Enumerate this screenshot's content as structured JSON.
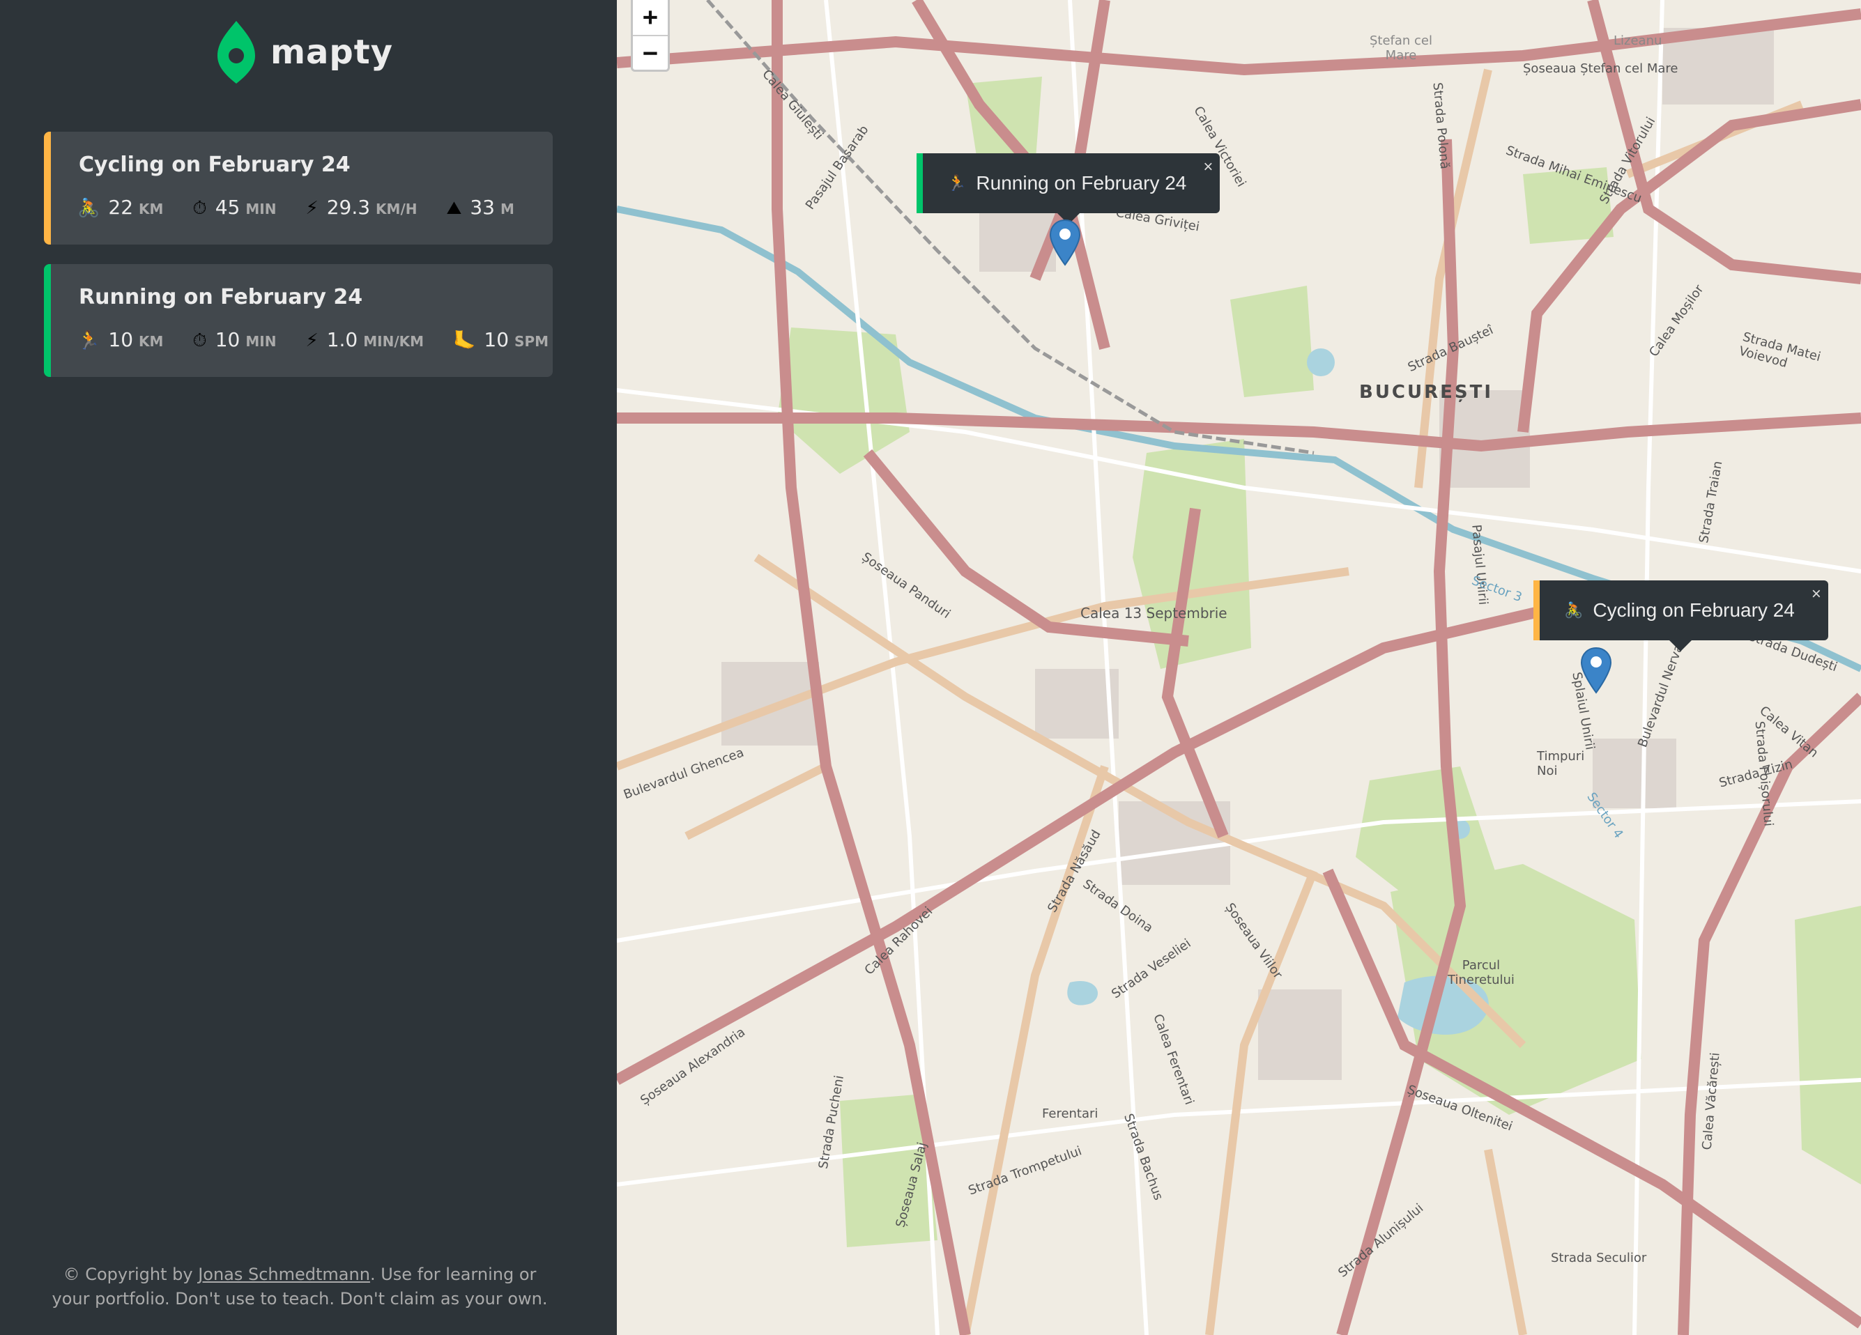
{
  "app": {
    "name": "mapty"
  },
  "workouts": [
    {
      "type": "cycling",
      "title": "Cycling on February 24",
      "details": [
        {
          "icon": "🚴",
          "value": "22",
          "unit": "km"
        },
        {
          "icon": "⏱",
          "value": "45",
          "unit": "min"
        },
        {
          "icon": "⚡",
          "value": "29.3",
          "unit": "km/h"
        },
        {
          "icon": "⛰",
          "value": "33",
          "unit": "m"
        }
      ]
    },
    {
      "type": "running",
      "title": "Running on February 24",
      "details": [
        {
          "icon": "🏃",
          "value": "10",
          "unit": "km"
        },
        {
          "icon": "⏱",
          "value": "10",
          "unit": "min"
        },
        {
          "icon": "⚡",
          "value": "1.0",
          "unit": "min/km"
        },
        {
          "icon": "🦶",
          "value": "10",
          "unit": "spm"
        }
      ]
    }
  ],
  "footer": {
    "prefix": "© Copyright by ",
    "link": "Jonas Schmedtmann",
    "suffix": ". Use for learning or your portfolio. Don't use to teach. Don't claim as your own."
  },
  "map": {
    "zoom_in": "+",
    "zoom_out": "−",
    "city_label": "BUCUREȘTI",
    "street_labels": [
      "Calea 13 Septembrie",
      "Șoseaua Panduri",
      "Bulevardul Ghencea",
      "Calea Rahovei",
      "Strada Năsăud",
      "Strada Doina",
      "Strada Veseliei",
      "Calea Ferentari",
      "Șoseaua Viilor",
      "Ferentari",
      "Strada Trompetului",
      "Strada Bachus",
      "Șoseaua Alexandria",
      "Strada Pucheni",
      "Șoseaua Salaj",
      "Parcul Tineretului",
      "Șoseaua Oltenitei",
      "Strada Seculior",
      "Strada Alunișului",
      "Calea Văcărești",
      "Timpuri Noi",
      "Strada Zizin",
      "Calea Vitan",
      "Splaiul Unirii",
      "Strada Mihai Eminescu",
      "Strada Matei Voievod",
      "Calea Moșilor",
      "Strada Traian",
      "Șoseaua Ștefan cel Mare",
      "Strada Polonă",
      "Calea Victoriei",
      "Calea Griviței",
      "Calea Giulești",
      "Pasajul Basarab",
      "Strada Baușteî",
      "Pasajul Unirii",
      "Sector 3",
      "Sector 4",
      "Bulevardul Nerva Traian",
      "Strada Foișorului",
      "Strada Dudești",
      "Ștefan cel Mare",
      "Lizeanu",
      "Strada Vitorului"
    ],
    "popups": [
      {
        "type": "running",
        "icon": "🏃",
        "label": "Running on February 24",
        "close": "×"
      },
      {
        "type": "cycling",
        "icon": "🚴",
        "label": "Cycling on February 24",
        "close": "×"
      }
    ]
  },
  "colors": {
    "sidebar_bg": "#2d3439",
    "card_bg": "#42484d",
    "running_accent": "#00c46a",
    "cycling_accent": "#ffb545",
    "marker": "#3b84c8"
  }
}
